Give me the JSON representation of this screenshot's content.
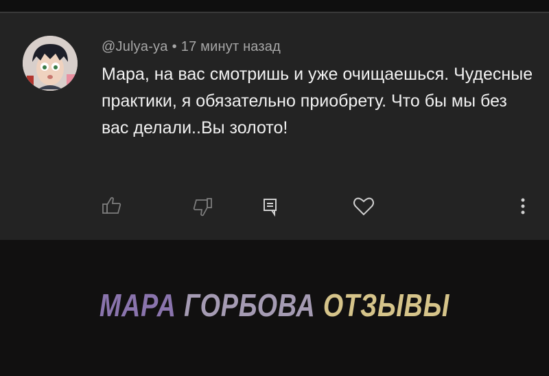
{
  "comment": {
    "author": "@Julya-ya",
    "separator": "•",
    "time": "17 минут назад",
    "text": "Мара, на вас смотришь и уже очищаешься. Чудесные практики, я обязательно приобрету. Что бы мы без вас делали..Вы золото!"
  },
  "actions": {
    "like_icon": "thumb-up-icon",
    "dislike_icon": "thumb-down-icon",
    "reply_icon": "reply-icon",
    "heart_icon": "heart-icon",
    "more_icon": "more-vertical-icon"
  },
  "banner": {
    "word1": "МАРА",
    "word2": "ГОРБОВА",
    "word3": "ОТЗЫВЫ"
  },
  "colors": {
    "card_bg": "#232323",
    "page_bg": "#111010",
    "text": "#f1f1f1",
    "meta": "#a7a7a7",
    "banner_purple": "#8a74ad",
    "banner_gold": "#d6c48a"
  }
}
